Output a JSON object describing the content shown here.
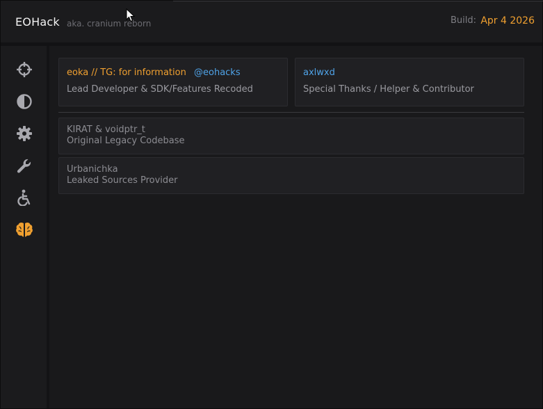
{
  "header": {
    "title": "EOHack",
    "subtitle": "aka. cranium reborn",
    "build_label": "Build:",
    "build_value": "Apr  4 2026"
  },
  "sidebar": {
    "items": [
      {
        "icon": "crosshair-icon",
        "active": false
      },
      {
        "icon": "contrast-icon",
        "active": false
      },
      {
        "icon": "gear-icon",
        "active": false
      },
      {
        "icon": "wrench-icon",
        "active": false
      },
      {
        "icon": "accessibility-icon",
        "active": false
      },
      {
        "icon": "brain-icon",
        "active": true
      }
    ]
  },
  "credits": {
    "lead": {
      "name": "eoka // TG: for information",
      "handle": "@eohacks",
      "role": "Lead Developer & SDK/Features Recoded"
    },
    "helper": {
      "name": "axlwxd",
      "role": "Special Thanks / Helper & Contributor"
    },
    "legacy": {
      "name": "KIRAT & voidptr_t",
      "role": "Original Legacy Codebase"
    },
    "leaks": {
      "name": "Urbanichka",
      "role": "Leaked Sources Provider"
    }
  },
  "colors": {
    "accent": "#f0a030",
    "link": "#4fa3e8",
    "icon_idle": "#a8a8ae",
    "background": "#1b1b1d"
  }
}
